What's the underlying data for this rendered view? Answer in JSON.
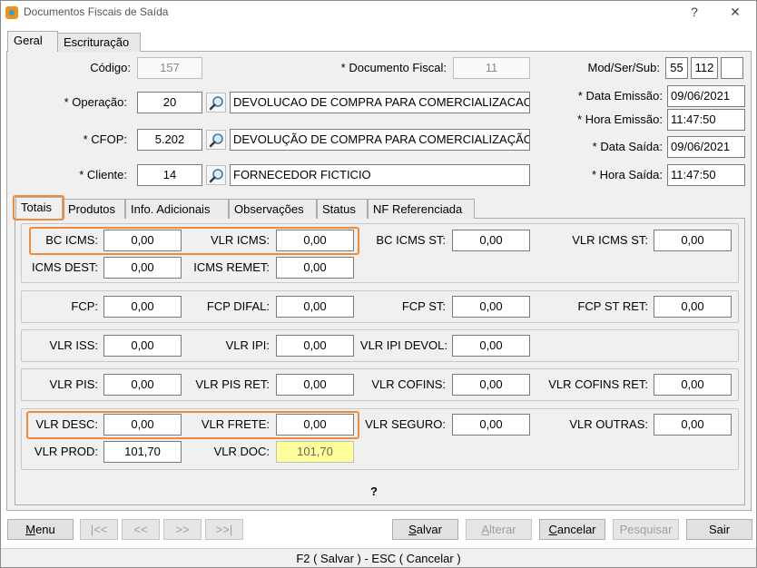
{
  "window": {
    "title": "Documentos Fiscais de Saída",
    "help_label": "?",
    "close_label": "✕"
  },
  "tabs": [
    "Geral",
    "Escrituração"
  ],
  "header": {
    "codigo_label": "Código:",
    "codigo_value": "157",
    "doc_fiscal_label": "* Documento Fiscal:",
    "doc_fiscal_value": "11",
    "modsersub_label": "Mod/Ser/Sub:",
    "mod_value": "55",
    "ser_value": "112",
    "sub_value": "",
    "operacao_label": "* Operação:",
    "operacao_code": "20",
    "operacao_desc": "DEVOLUCAO DE COMPRA PARA COMERCIALIZACAO",
    "cfop_label": "* CFOP:",
    "cfop_code": "5.202",
    "cfop_desc": "DEVOLUÇÃO DE COMPRA PARA COMERCIALIZAÇÃO",
    "cliente_label": "* Cliente:",
    "cliente_code": "14",
    "cliente_desc": "FORNECEDOR FICTICIO",
    "data_emissao_label": "* Data Emissão:",
    "data_emissao_value": "09/06/2021",
    "hora_emissao_label": "* Hora Emissão:",
    "hora_emissao_value": "11:47:50",
    "data_saida_label": "* Data Saída:",
    "data_saida_value": "09/06/2021",
    "hora_saida_label": "* Hora Saída:",
    "hora_saida_value": "11:47:50"
  },
  "inner_tabs": [
    "Totais",
    "Produtos",
    "Info. Adicionais",
    "Observações",
    "Status",
    "NF Referenciada"
  ],
  "totais": {
    "bc_icms": {
      "label": "BC ICMS:",
      "value": "0,00"
    },
    "vlr_icms": {
      "label": "VLR ICMS:",
      "value": "0,00"
    },
    "bc_icms_st": {
      "label": "BC ICMS ST:",
      "value": "0,00"
    },
    "vlr_icms_st": {
      "label": "VLR ICMS ST:",
      "value": "0,00"
    },
    "icms_dest": {
      "label": "ICMS DEST:",
      "value": "0,00"
    },
    "icms_remet": {
      "label": "ICMS REMET:",
      "value": "0,00"
    },
    "fcp": {
      "label": "FCP:",
      "value": "0,00"
    },
    "fcp_difal": {
      "label": "FCP DIFAL:",
      "value": "0,00"
    },
    "fcp_st": {
      "label": "FCP ST:",
      "value": "0,00"
    },
    "fcp_st_ret": {
      "label": "FCP ST RET:",
      "value": "0,00"
    },
    "vlr_iss": {
      "label": "VLR ISS:",
      "value": "0,00"
    },
    "vlr_ipi": {
      "label": "VLR IPI:",
      "value": "0,00"
    },
    "vlr_ipi_devol": {
      "label": "VLR IPI DEVOL:",
      "value": "0,00"
    },
    "vlr_pis": {
      "label": "VLR PIS:",
      "value": "0,00"
    },
    "vlr_pis_ret": {
      "label": "VLR PIS RET:",
      "value": "0,00"
    },
    "vlr_cofins": {
      "label": "VLR COFINS:",
      "value": "0,00"
    },
    "vlr_cofins_ret": {
      "label": "VLR COFINS RET:",
      "value": "0,00"
    },
    "vlr_desc": {
      "label": "VLR DESC:",
      "value": "0,00"
    },
    "vlr_frete": {
      "label": "VLR FRETE:",
      "value": "0,00"
    },
    "vlr_seguro": {
      "label": "VLR SEGURO:",
      "value": "0,00"
    },
    "vlr_outras": {
      "label": "VLR OUTRAS:",
      "value": "0,00"
    },
    "vlr_prod": {
      "label": "VLR PROD:",
      "value": "101,70"
    },
    "vlr_doc": {
      "label": "VLR DOC:",
      "value": "101,70"
    },
    "help_mark": "?"
  },
  "buttons": {
    "menu": {
      "pre": "",
      "ul": "M",
      "post": "enu"
    },
    "first": "|<<",
    "prev": "<<",
    "next": ">>",
    "last": ">>|",
    "salvar": {
      "pre": "",
      "ul": "S",
      "post": "alvar"
    },
    "alterar": {
      "pre": "",
      "ul": "A",
      "post": "lterar"
    },
    "cancelar": {
      "pre": "",
      "ul": "C",
      "post": "ancelar"
    },
    "pesquisar": "Pesquisar",
    "sair": "Sair"
  },
  "statusbar": "F2 ( Salvar )  -  ESC ( Cancelar )",
  "colors": {
    "highlight": "#f08a3c",
    "doc_total_bg": "#ffff99"
  }
}
